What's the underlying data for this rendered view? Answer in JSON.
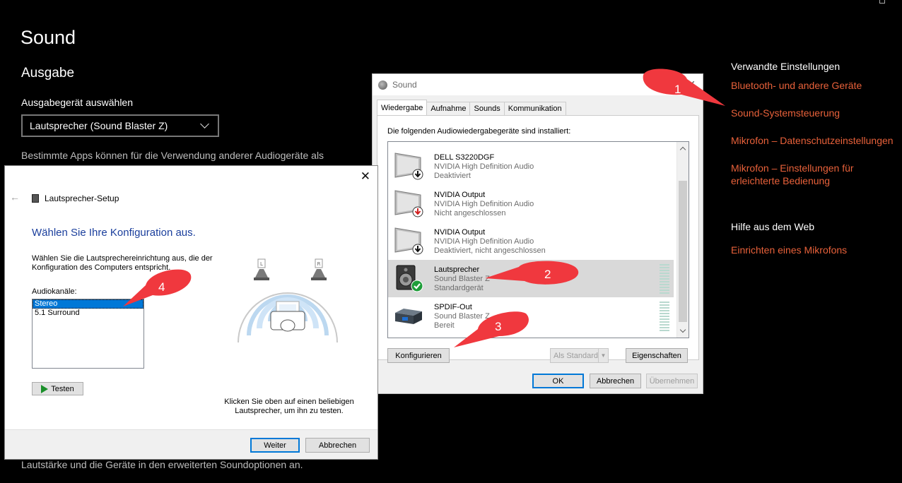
{
  "settings": {
    "title": "Sound",
    "section": "Ausgabe",
    "output_label": "Ausgabegerät auswählen",
    "output_device": "Lautsprecher (Sound Blaster Z)",
    "desc_top": "Bestimmte Apps können für die Verwendung anderer Audiogeräte als",
    "desc_bottom": "Lautstärke und die Geräte in den erweiterten Soundoptionen an.",
    "related_head": "Verwandte Einstellungen",
    "related_links": [
      "Bluetooth- und andere Geräte",
      "Sound-Systemsteuerung",
      "Mikrofon – Datenschutzeinstellungen",
      "Mikrofon – Einstellungen für erleichterte Bedienung"
    ],
    "help_head": "Hilfe aus dem Web",
    "help_links": [
      "Einrichten eines Mikrofons"
    ],
    "link_color": "#e8613a"
  },
  "sound_dialog": {
    "title": "Sound",
    "tabs": [
      "Wiedergabe",
      "Aufnahme",
      "Sounds",
      "Kommunikation"
    ],
    "intro": "Die folgenden Audiowiedergabegeräte sind installiert:",
    "devices": [
      {
        "name": "DELL S3220DGF",
        "driver": "NVIDIA High Definition Audio",
        "status": "Deaktiviert",
        "icon": "monitor-icon",
        "badge": "down-arrow-icon"
      },
      {
        "name": "NVIDIA Output",
        "driver": "NVIDIA High Definition Audio",
        "status": "Nicht angeschlossen",
        "icon": "monitor-icon",
        "badge": "red-down-arrow-icon"
      },
      {
        "name": "NVIDIA Output",
        "driver": "NVIDIA High Definition Audio",
        "status": "Deaktiviert, nicht angeschlossen",
        "icon": "monitor-icon",
        "badge": "down-arrow-icon"
      },
      {
        "name": "Lautsprecher",
        "driver": "Sound Blaster Z",
        "status": "Standardgerät",
        "icon": "speaker-icon",
        "badge": "check-icon"
      },
      {
        "name": "SPDIF-Out",
        "driver": "Sound Blaster Z",
        "status": "Bereit",
        "icon": "spdif-device-icon",
        "badge": ""
      }
    ],
    "btn_configure": "Konfigurieren",
    "btn_default": "Als Standard",
    "btn_properties": "Eigenschaften",
    "btn_ok": "OK",
    "btn_cancel": "Abbrechen",
    "btn_apply": "Übernehmen"
  },
  "speaker_setup": {
    "title": "Lautsprecher-Setup",
    "heading": "Wählen Sie Ihre Konfiguration aus.",
    "desc": "Wählen Sie die Lautsprechereinrichtung aus, die der Konfiguration des Computers entspricht.",
    "channels_label": "Audiokanäle:",
    "channels": [
      "Stereo",
      "5.1 Surround"
    ],
    "btn_test": "Testen",
    "hint": "Klicken Sie oben auf einen beliebigen Lautsprecher, um ihn zu testen.",
    "speaker_left": "L",
    "speaker_right": "R",
    "btn_next": "Weiter",
    "btn_cancel": "Abbrechen"
  },
  "annotations": [
    "1",
    "2",
    "3",
    "4"
  ],
  "colors": {
    "annotation": "#f0383e",
    "selection": "#0078d7"
  }
}
